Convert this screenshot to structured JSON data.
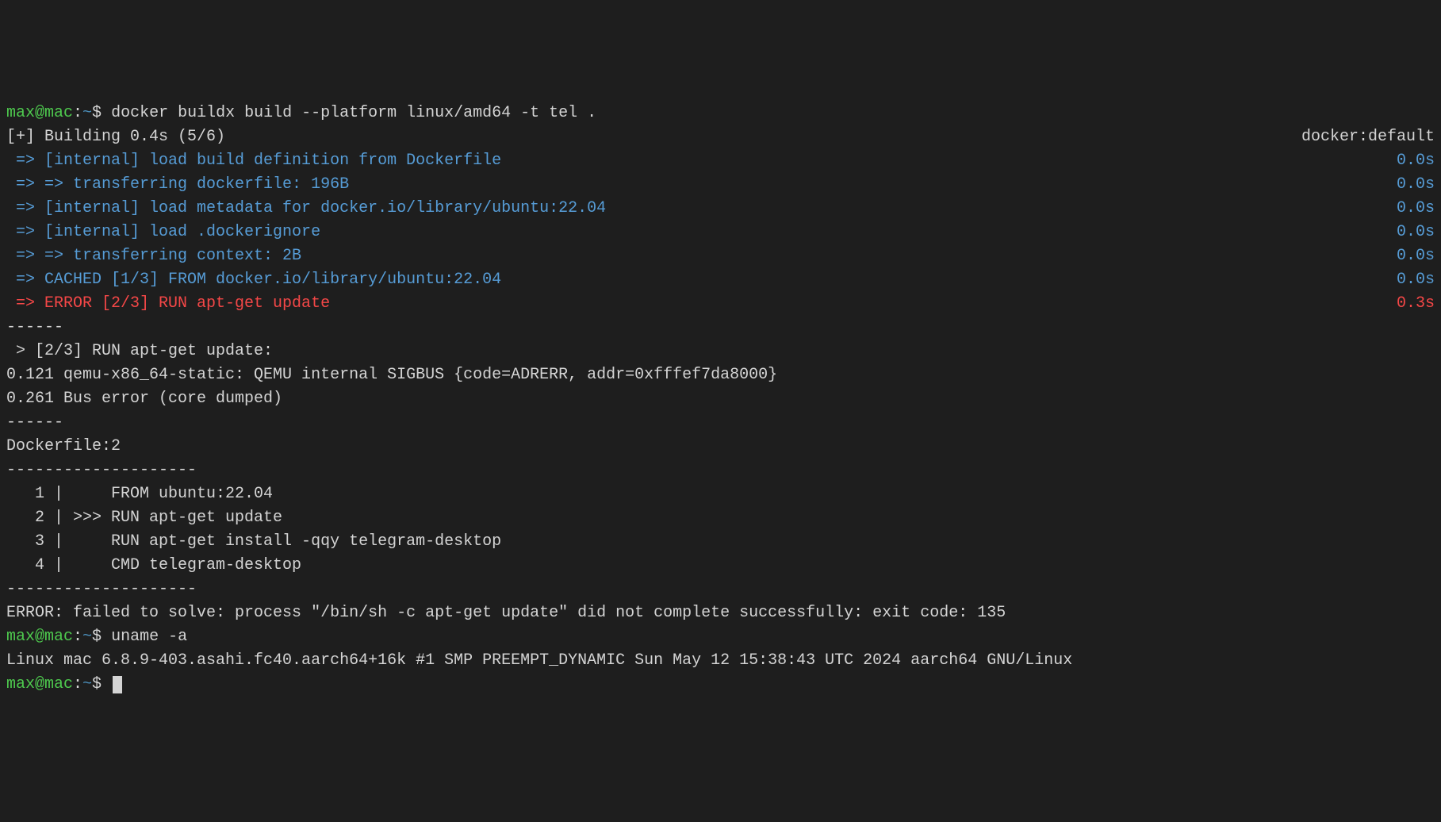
{
  "prompt1": {
    "user_host": "max@mac",
    "colon": ":",
    "path": "~",
    "dollar": "$ ",
    "command": "docker buildx build --platform linux/amd64 -t tel ."
  },
  "build_header": {
    "left": "[+] Building 0.4s (5/6)",
    "right": "docker:default"
  },
  "steps": [
    {
      "text": " => [internal] load build definition from Dockerfile",
      "time": "0.0s",
      "color": "blue"
    },
    {
      "text": " => => transferring dockerfile: 196B",
      "time": "0.0s",
      "color": "blue"
    },
    {
      "text": " => [internal] load metadata for docker.io/library/ubuntu:22.04",
      "time": "0.0s",
      "color": "blue"
    },
    {
      "text": " => [internal] load .dockerignore",
      "time": "0.0s",
      "color": "blue"
    },
    {
      "text": " => => transferring context: 2B",
      "time": "0.0s",
      "color": "blue"
    },
    {
      "text": " => CACHED [1/3] FROM docker.io/library/ubuntu:22.04",
      "time": "0.0s",
      "color": "blue"
    },
    {
      "text": " => ERROR [2/3] RUN apt-get update",
      "time": "0.3s",
      "color": "red"
    }
  ],
  "divider1": "------",
  "err_header": " > [2/3] RUN apt-get update:",
  "err_line1": "0.121 qemu-x86_64-static: QEMU internal SIGBUS {code=ADRERR, addr=0xfffef7da8000}",
  "err_line2": "0.261 Bus error (core dumped)",
  "divider2": "------",
  "dockerfile_label": "Dockerfile:2",
  "divider3": "--------------------",
  "df_lines": [
    "   1 |     FROM ubuntu:22.04",
    "   2 | >>> RUN apt-get update",
    "   3 |     RUN apt-get install -qqy telegram-desktop",
    "   4 |     CMD telegram-desktop"
  ],
  "divider4": "--------------------",
  "final_error": "ERROR: failed to solve: process \"/bin/sh -c apt-get update\" did not complete successfully: exit code: 135",
  "prompt2": {
    "user_host": "max@mac",
    "colon": ":",
    "path": "~",
    "dollar": "$ ",
    "command": "uname -a"
  },
  "uname_output": "Linux mac 6.8.9-403.asahi.fc40.aarch64+16k #1 SMP PREEMPT_DYNAMIC Sun May 12 15:38:43 UTC 2024 aarch64 GNU/Linux",
  "prompt3": {
    "user_host": "max@mac",
    "colon": ":",
    "path": "~",
    "dollar": "$ "
  }
}
